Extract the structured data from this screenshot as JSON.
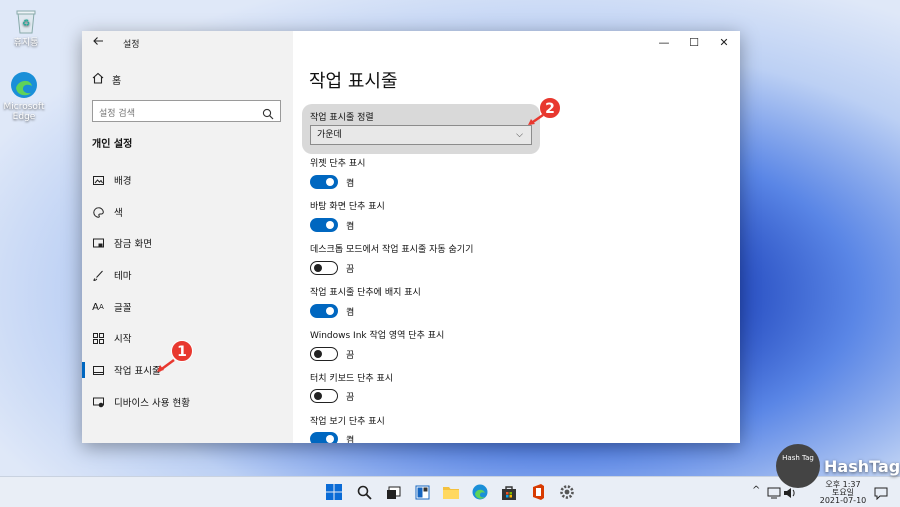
{
  "desktop": {
    "recycle_bin_label": "휴지통",
    "edge_label": "Microsoft Edge"
  },
  "window": {
    "title": "설정",
    "controls": {
      "minimize": "—",
      "maximize": "☐",
      "close": "✕"
    }
  },
  "sidebar": {
    "home_label": "홈",
    "search_placeholder": "설정 검색",
    "section_title": "개인 설정",
    "items": [
      {
        "label": "배경",
        "icon": "image-icon"
      },
      {
        "label": "색",
        "icon": "palette-icon"
      },
      {
        "label": "잠금 화면",
        "icon": "lock-screen-icon"
      },
      {
        "label": "테마",
        "icon": "brush-icon"
      },
      {
        "label": "글꼴",
        "icon": "font-icon"
      },
      {
        "label": "시작",
        "icon": "start-grid-icon"
      },
      {
        "label": "작업 표시줄",
        "icon": "taskbar-icon",
        "active": true
      },
      {
        "label": "디바이스 사용 현황",
        "icon": "device-usage-icon"
      }
    ]
  },
  "content": {
    "title": "작업 표시줄",
    "alignment": {
      "label": "작업 표시줄 정렬",
      "value": "가운데"
    },
    "toggles": [
      {
        "label": "위젯 단추 표시",
        "state": "켬",
        "on": true
      },
      {
        "label": "바탕 화면 단추 표시",
        "state": "켬",
        "on": true
      },
      {
        "label": "데스크톱 모드에서 작업 표시줄 자동 숨기기",
        "state": "끔",
        "on": false
      },
      {
        "label": "작업 표시줄 단추에 배지 표시",
        "state": "켬",
        "on": true
      },
      {
        "label": "Windows Ink 작업 영역 단추 표시",
        "state": "끔",
        "on": false
      },
      {
        "label": "터치 키보드 단추 표시",
        "state": "끔",
        "on": false
      },
      {
        "label": "작업 보기 단추 표시",
        "state": "켬",
        "on": true
      }
    ]
  },
  "callouts": [
    "1",
    "2"
  ],
  "tray": {
    "time": "오후 1:37",
    "day": "토요일",
    "date": "2021-07-10",
    "chevron": "^"
  },
  "watermark": {
    "badge": "Hash Tag",
    "text": "HashTag"
  },
  "colors": {
    "accent": "#0067c0",
    "callout": "#e8382f",
    "sidebar_bg": "#f2f2f2"
  }
}
